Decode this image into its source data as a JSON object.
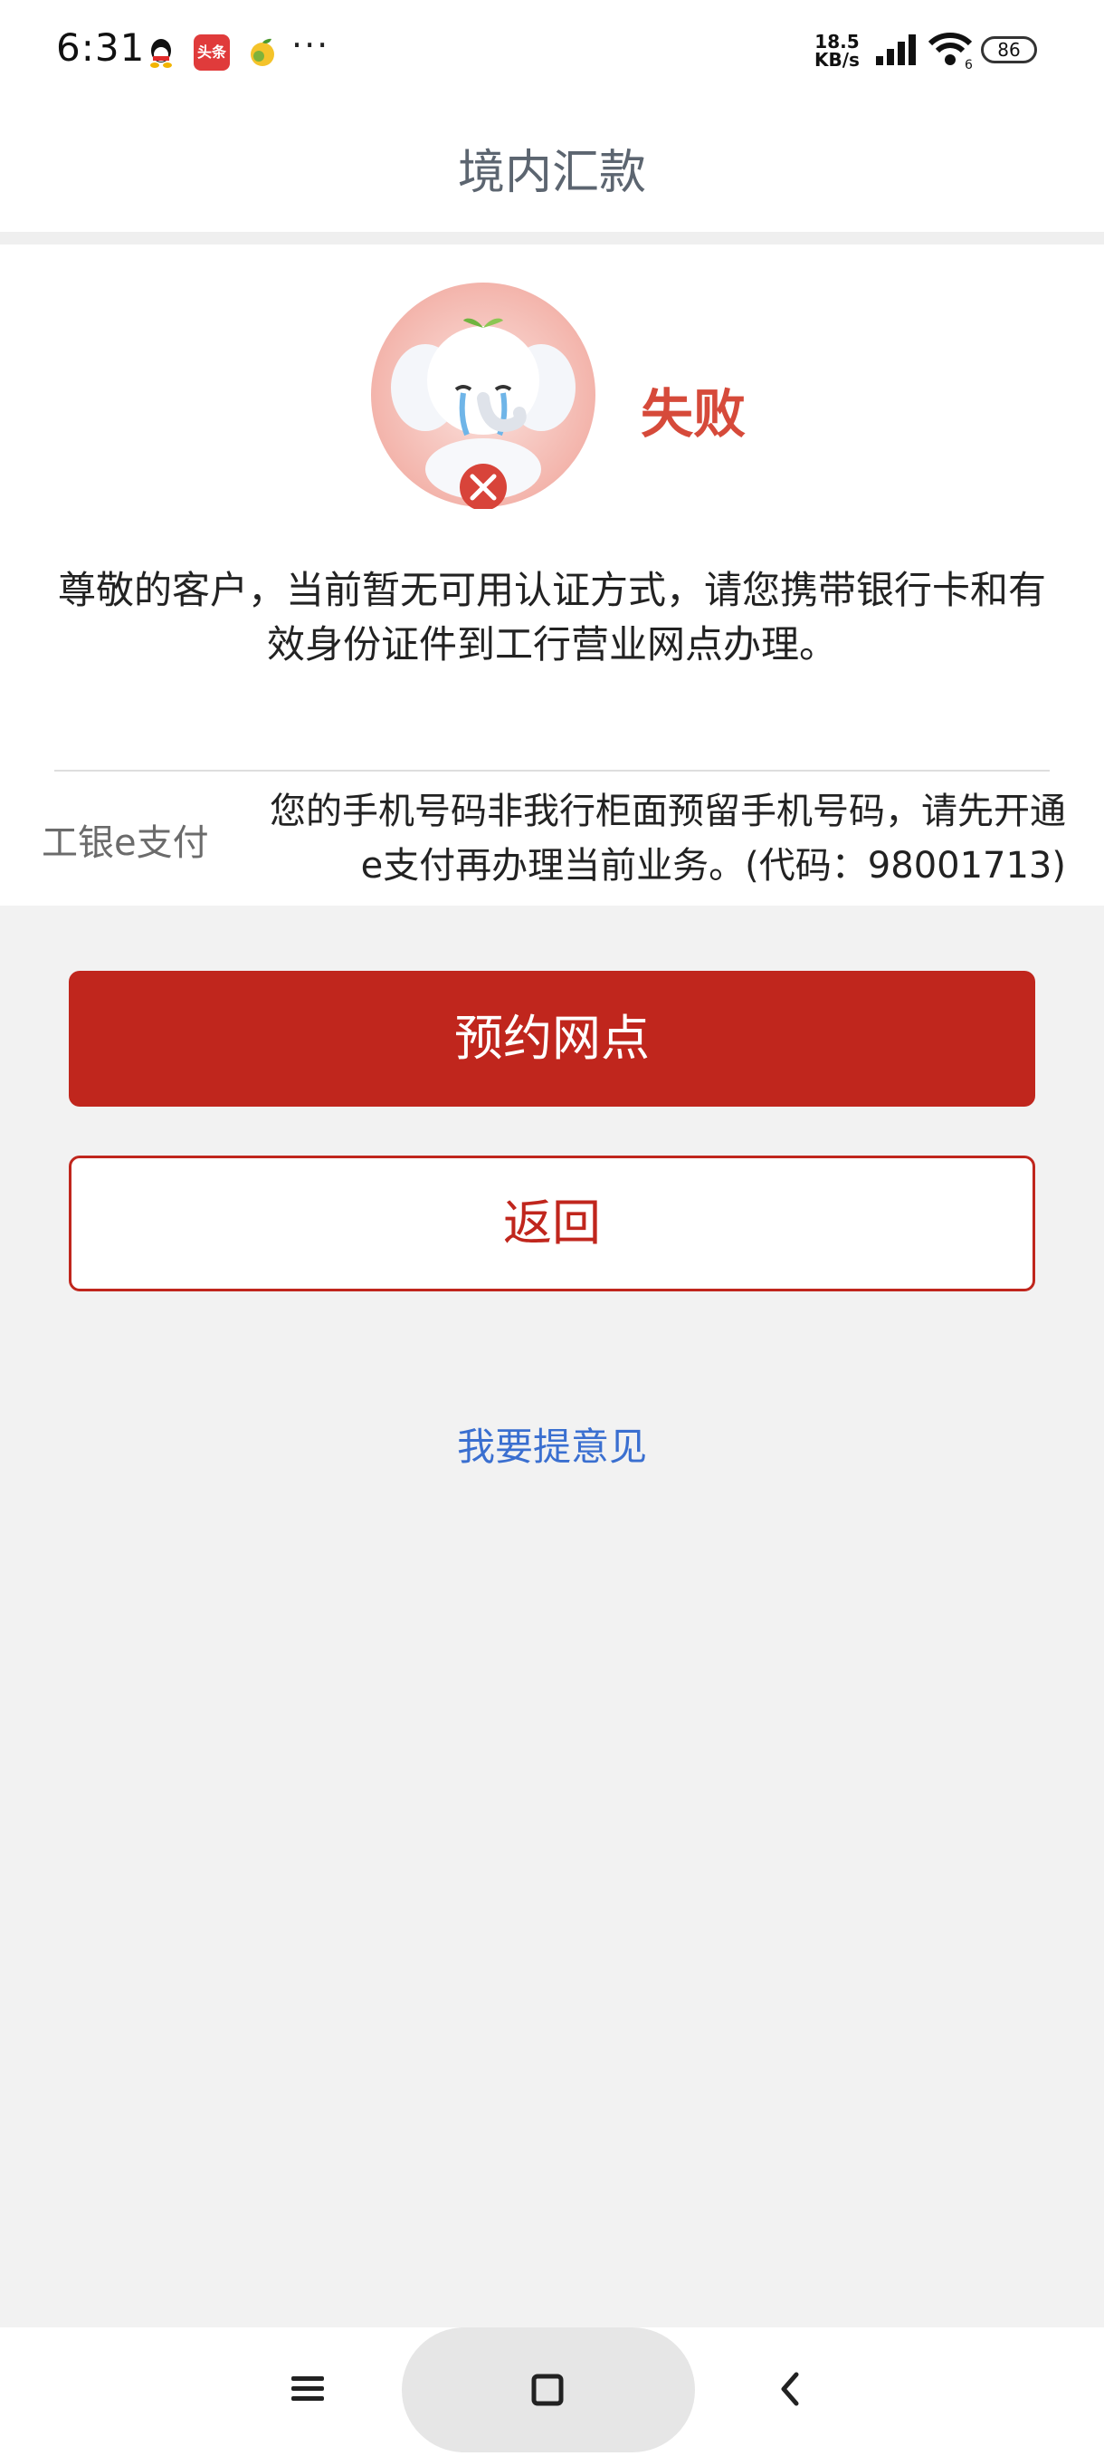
{
  "status_bar": {
    "time": "6:31",
    "app_icons": [
      "qq-icon",
      "toutiao-icon",
      "fruit-app-icon"
    ],
    "toutiao_label": "头条",
    "more": "···",
    "network_speed_value": "18.5",
    "network_speed_unit": "KB/s",
    "battery": "86"
  },
  "header": {
    "title": "境内汇款"
  },
  "result": {
    "status": "失败",
    "message": "尊敬的客户，当前暂无可用认证方式，请您携带银行卡和有效身份证件到工行营业网点办理。",
    "detail_label": "工银e支付",
    "detail_value": "您的手机号码非我行柜面预留手机号码，请先开通e支付再办理当前业务。(代码：98001713)"
  },
  "actions": {
    "primary": "预约网点",
    "secondary": "返回",
    "feedback": "我要提意见"
  },
  "colors": {
    "brand_red": "#c0261d",
    "fail_red": "#d64a3a",
    "link_blue": "#3a6fd0"
  },
  "nav_bar": {
    "icons": [
      "menu-icon",
      "home-square-icon",
      "back-chevron-icon"
    ]
  }
}
